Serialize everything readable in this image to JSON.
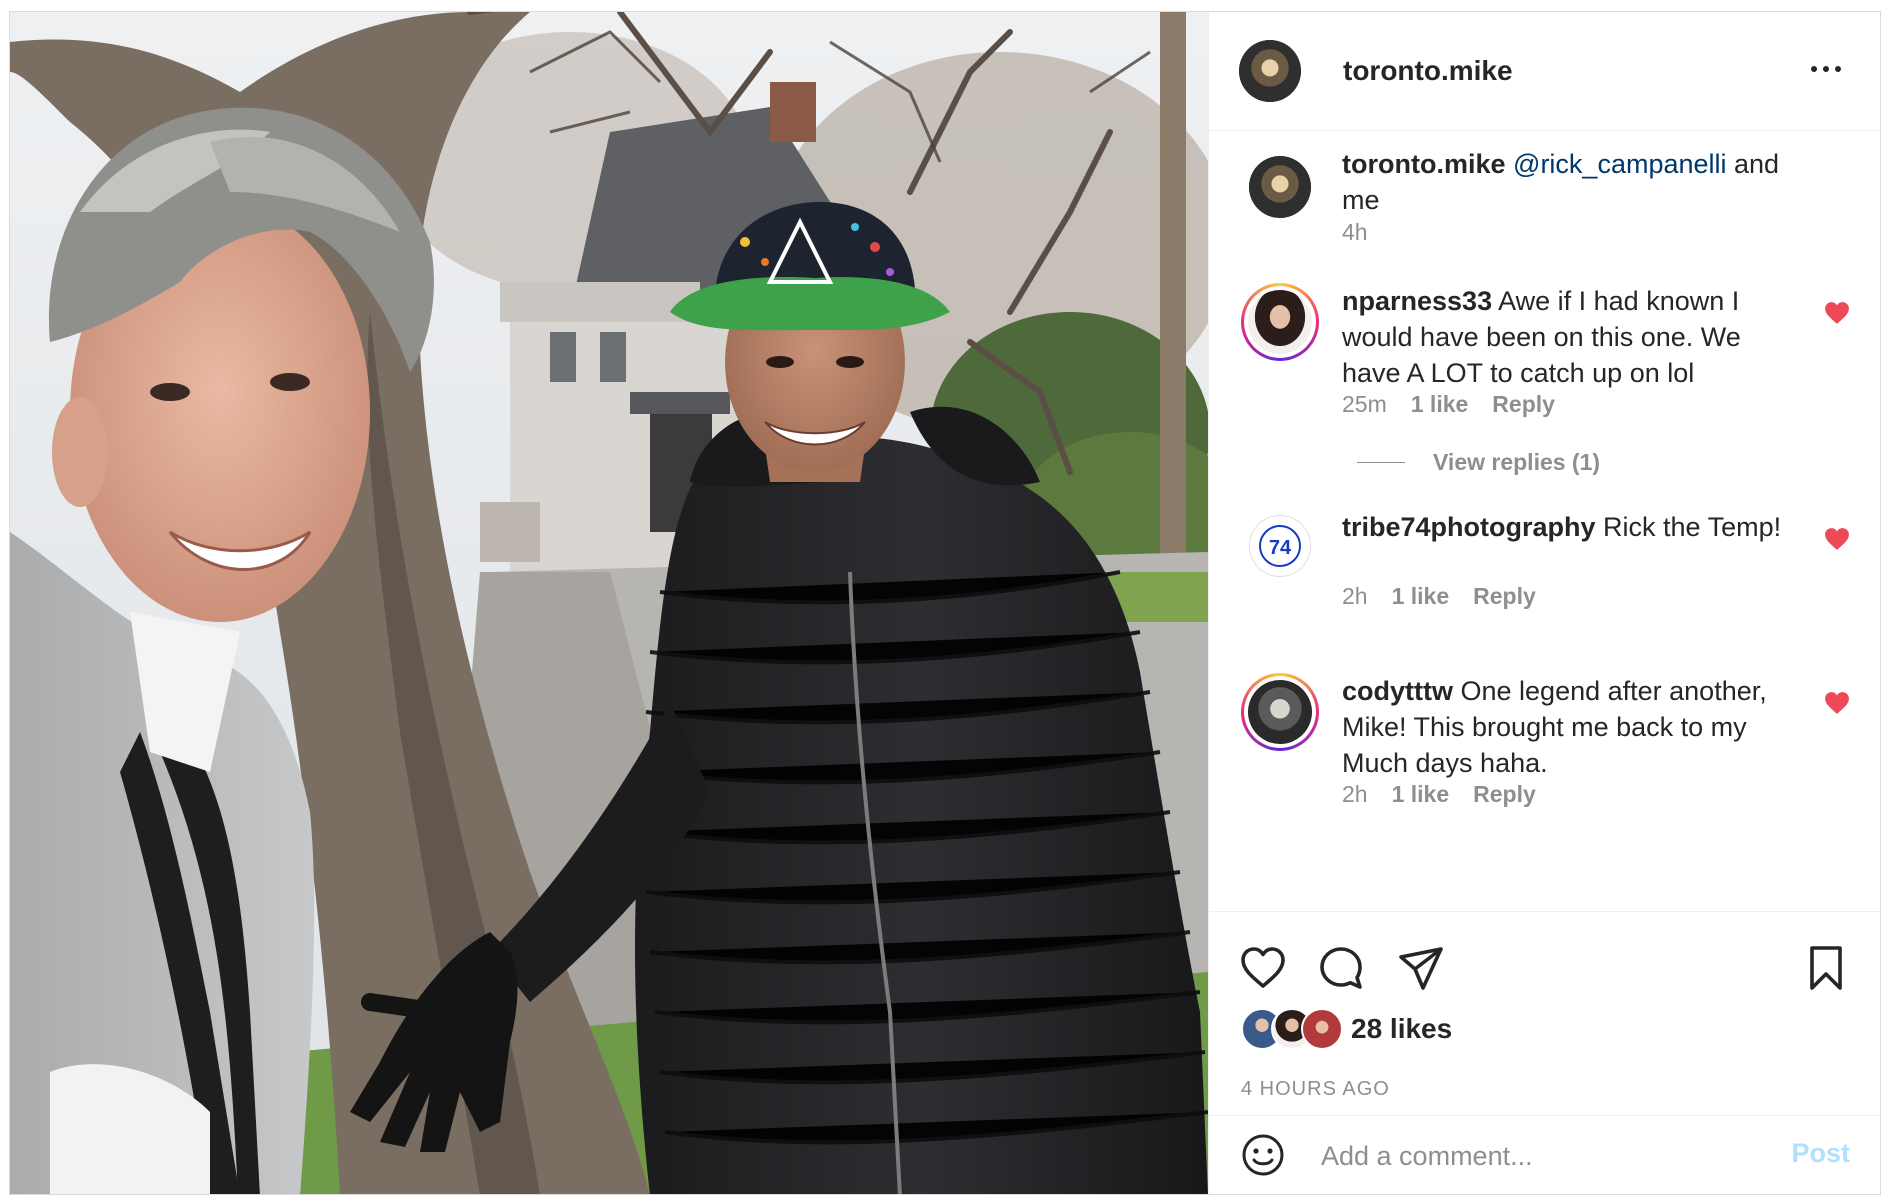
{
  "post": {
    "username": "toronto.mike",
    "more_icon": "more-horizontal-icon"
  },
  "caption": {
    "username": "toronto.mike",
    "mention": "@rick_campanelli",
    "text": " and me",
    "time": "4h"
  },
  "comments": [
    {
      "username": "nparness33",
      "text": " Awe if I had known I would have been on this one. We have A LOT to catch up on lol",
      "time": "25m",
      "likes": "1 like",
      "reply": "Reply",
      "liked": true,
      "view_replies": "View replies (1)"
    },
    {
      "username": "tribe74photography",
      "text": " Rick the Temp!",
      "time": "2h",
      "likes": "1 like",
      "reply": "Reply",
      "liked": true
    },
    {
      "username": "codytttw",
      "text": " One legend after another, Mike! This brought me back to my Much days haha.",
      "time": "2h",
      "likes": "1 like",
      "reply": "Reply",
      "liked": true
    }
  ],
  "actions": {
    "like_icon": "heart-outline-icon",
    "comment_icon": "comment-icon",
    "share_icon": "send-icon",
    "save_icon": "bookmark-icon",
    "likes_count": "28 likes",
    "posted_ago": "4 HOURS AGO"
  },
  "add_comment": {
    "placeholder": "Add a comment...",
    "post_label": "Post",
    "emoji_icon": "smiley-icon"
  },
  "colors": {
    "like_red": "#ed4956",
    "mention_blue": "#00376b",
    "post_button_disabled": "#b2dffc",
    "meta_gray": "#8e8e8e"
  }
}
